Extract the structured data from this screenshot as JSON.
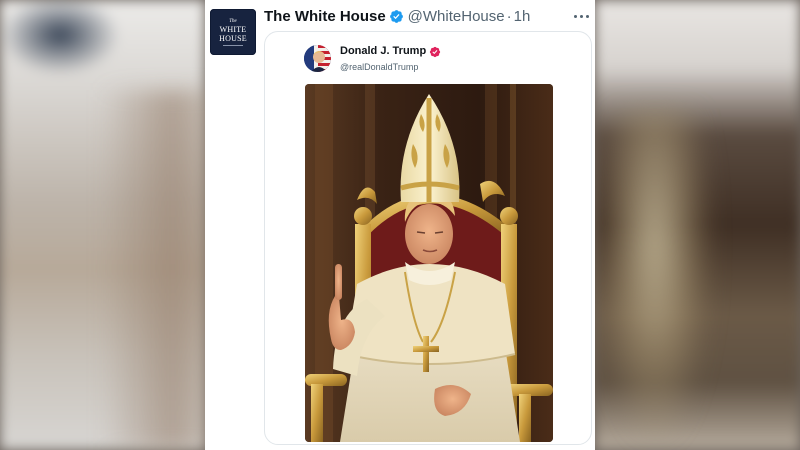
{
  "tweet": {
    "display_name": "The White House",
    "handle": "@WhiteHouse",
    "separator": "·",
    "time": "1h",
    "avatar": {
      "small_text": "The",
      "line1": "WHITE",
      "line2": "HOUSE"
    },
    "verified_icon": "verified-badge-icon",
    "more_icon": "more-options-icon"
  },
  "quoted_tweet": {
    "display_name": "Donald J. Trump",
    "handle": "@realDonaldTrump",
    "verified_icon": "verified-badge-icon",
    "image_alt": "Image of a man dressed in white papal vestments and a golden mitre seated on an ornate golden throne, raising one finger"
  },
  "colors": {
    "verified_blue": "#1d9bf0",
    "name_text": "#0f1419",
    "secondary_text": "#536471",
    "border": "#e1e6ea",
    "avatar_navy": "#17233f"
  }
}
